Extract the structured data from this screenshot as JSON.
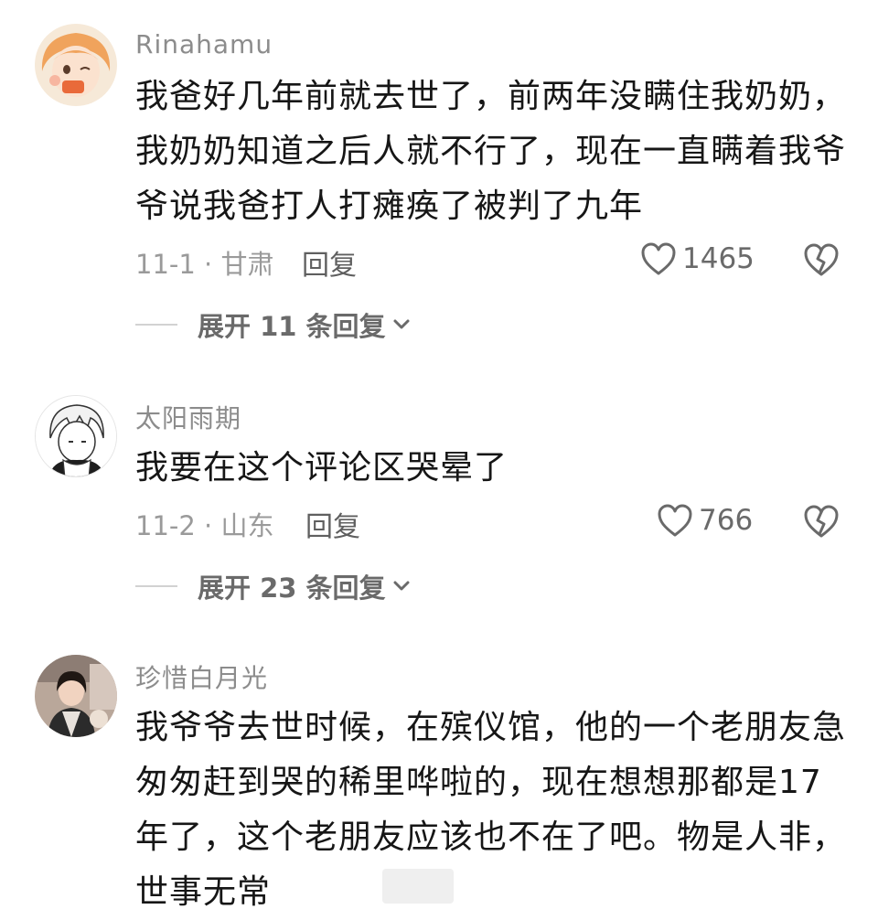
{
  "comments": [
    {
      "username": "Rinahamu",
      "text": "我爸好几年前就去世了，前两年没瞒住我奶奶，我奶奶知道之后人就不行了，现在一直瞒着我爷爷说我爸打人打瘫痪了被判了九年",
      "meta": "11-1 · 甘肃",
      "reply_label": "回复",
      "likes": "1465",
      "expand_label": "展开 11 条回复",
      "avatar_icon": "anime-girl-avatar"
    },
    {
      "username": "太阳雨期",
      "text": "我要在这个评论区哭晕了",
      "meta": "11-2 · 山东",
      "reply_label": "回复",
      "likes": "766",
      "expand_label": "展开 23 条回复",
      "avatar_icon": "sketch-boy-avatar"
    },
    {
      "username": "珍惜白月光",
      "text": "我爷爷去世时候，在殡仪馆，他的一个老朋友急匆匆赶到哭的稀里哗啦的，现在想想那都是17年了，这个老朋友应该也不在了吧。物是人非，世事无常",
      "avatar_icon": "photo-avatar"
    }
  ],
  "colors": {
    "username": "#8c8c8c",
    "body_text": "#161616",
    "meta": "#9a9a9a",
    "icon": "#6a6a6a"
  }
}
